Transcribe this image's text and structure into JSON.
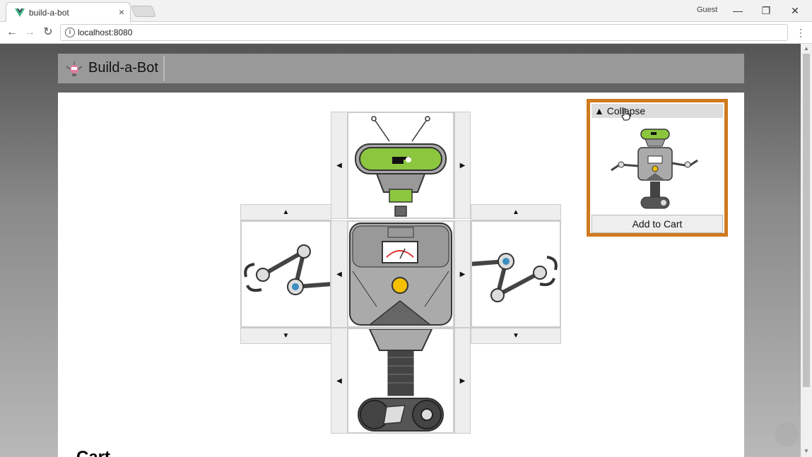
{
  "browser": {
    "tab_title": "build-a-bot",
    "tab_close": "×",
    "profile": "Guest",
    "window_min": "—",
    "window_restore": "❐",
    "window_close": "✕",
    "nav_back": "←",
    "nav_forward": "→",
    "nav_reload": "↻",
    "url": "localhost:8080",
    "menu": "⋮"
  },
  "app": {
    "brand": "Build-a-Bot"
  },
  "builder": {
    "head_prev": "◀",
    "head_next": "▶",
    "left_arm_up": "▲",
    "left_arm_down": "▼",
    "right_arm_up": "▲",
    "right_arm_down": "▼",
    "torso_prev": "◀",
    "torso_next": "▶",
    "base_prev": "◀",
    "base_next": "▶"
  },
  "preview": {
    "collapse_label": "▲ Collapse",
    "add_to_cart_label": "Add to Cart"
  },
  "cart": {
    "title": "Cart"
  },
  "colors": {
    "accent": "#d07a1e",
    "robot_green": "#8cc63f",
    "header_bg": "#999999"
  }
}
